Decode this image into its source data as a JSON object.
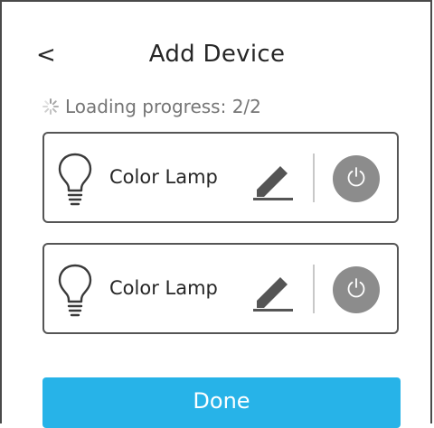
{
  "header": {
    "back_label": "<",
    "title": "Add Device"
  },
  "progress": {
    "text": "Loading progress: 2/2",
    "icon": "spinner-icon"
  },
  "devices": [
    {
      "name": "Color Lamp",
      "icon": "lightbulb-icon",
      "edit_icon": "pencil-icon",
      "power_icon": "power-icon"
    },
    {
      "name": "Color Lamp",
      "icon": "lightbulb-icon",
      "edit_icon": "pencil-icon",
      "power_icon": "power-icon"
    }
  ],
  "footer": {
    "done_label": "Done"
  },
  "colors": {
    "accent": "#27b3e8",
    "power_button": "#8c8c8c",
    "text": "#262626",
    "muted_text": "#757575"
  }
}
